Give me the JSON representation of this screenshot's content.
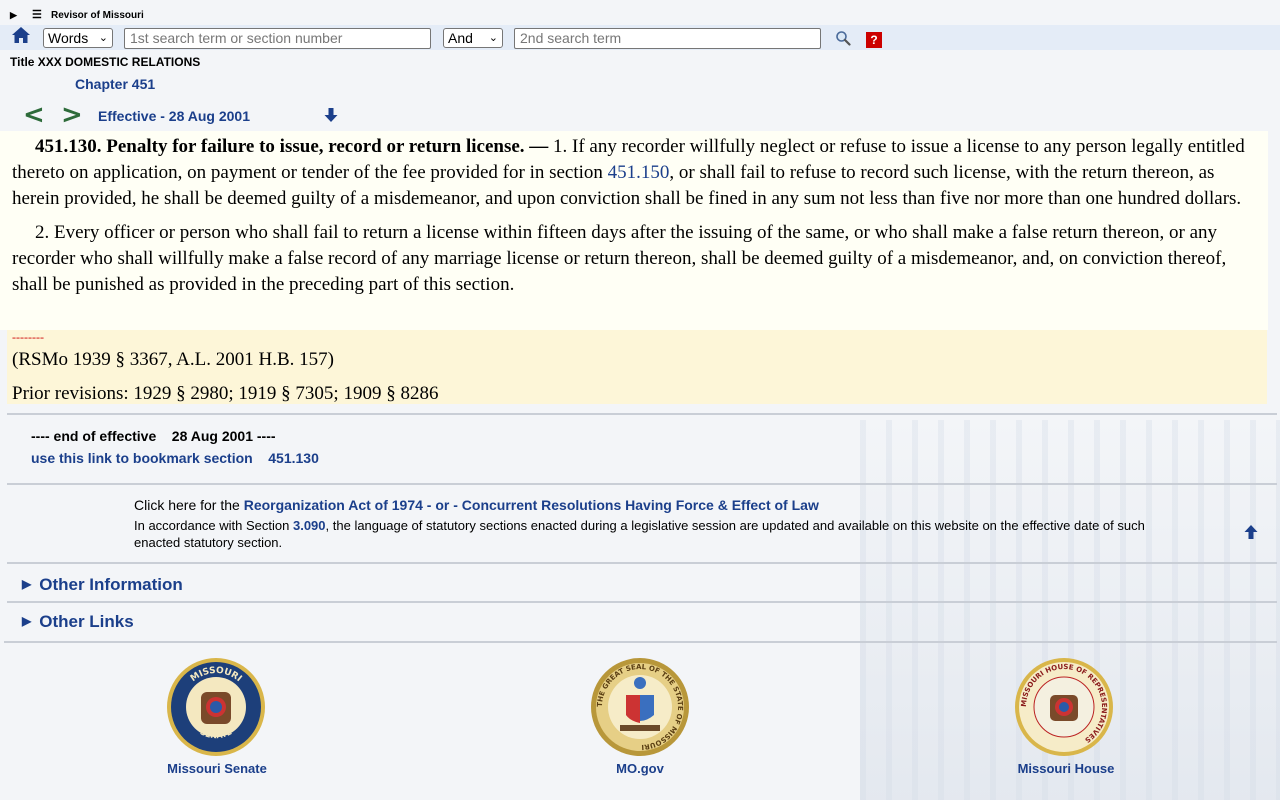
{
  "header": {
    "site_title": "Revisor of Missouri"
  },
  "search": {
    "mode_value": "Words",
    "term1_placeholder": "1st search term or section number",
    "operator_value": "And",
    "term2_placeholder": "2nd search term",
    "help_label": "?"
  },
  "breadcrumb": {
    "title": "Title XXX DOMESTIC RELATIONS",
    "chapter": "Chapter 451"
  },
  "nav": {
    "prev": "<",
    "next": ">",
    "effective": "Effective - 28 Aug 2001"
  },
  "section": {
    "heading": "451.130.  Penalty for failure to issue, record or return license. — ",
    "p1_start": "1.  If any recorder willfully neglect or refuse to issue a license to any person legally entitled thereto on application, on payment or tender of the fee provided for in section ",
    "p1_link": "451.150",
    "p1_end": ", or shall fail to refuse to record such license, with the return thereon, as herein provided, he shall be deemed guilty of a misdemeanor, and upon conviction shall be fined in any sum not less than five nor more than one hundred dollars.",
    "p2": "2.  Every officer or person who shall fail to return a license within fifteen days after the issuing of the same, or who shall make a false return thereon, or any recorder who shall willfully make a false record of any marriage license or return thereon, shall be deemed guilty of a misdemeanor, and, on conviction thereof, shall be punished as provided in the preceding part of this section."
  },
  "history": {
    "dashes": "--------",
    "source": "(RSMo 1939 § 3367, A.L. 2001 H.B. 157)",
    "prior": "Prior revisions: 1929 § 2980; 1919 § 7305; 1909 § 8286"
  },
  "footer_effective": {
    "end_text": "---- end of effective    28 Aug 2001 ----",
    "bookmark_text": "use this link to bookmark section    451.130"
  },
  "notice": {
    "click_prefix": "Click here for the ",
    "reorg_link": "Reorganization Act of 1974",
    "sep": " - or - ",
    "concurrent_link": "Concurrent Resolutions Having Force & Effect of Law",
    "line2_prefix": "In accordance with Section ",
    "line2_link": "3.090",
    "line2_suffix": ", the language of statutory sections enacted during a legislative session are updated and available on this website on the effective date of such enacted statutory section."
  },
  "sections": {
    "other_info": "Other Information",
    "other_links": "Other Links"
  },
  "seals": {
    "senate": "Missouri Senate",
    "mo_gov": "MO.gov",
    "house": "Missouri House",
    "senate_top": "MISSOURI",
    "senate_bottom": "SENATE",
    "state_ring": "THE GREAT SEAL OF THE STATE OF MISSOURI",
    "house_ring": "MISSOURI HOUSE OF REPRESENTATIVES"
  },
  "colors": {
    "link": "#1b3f8b",
    "nav_arrow": "#2d6b3a",
    "content_bg": "#fffff5",
    "history_bg": "#fdf6d8"
  }
}
